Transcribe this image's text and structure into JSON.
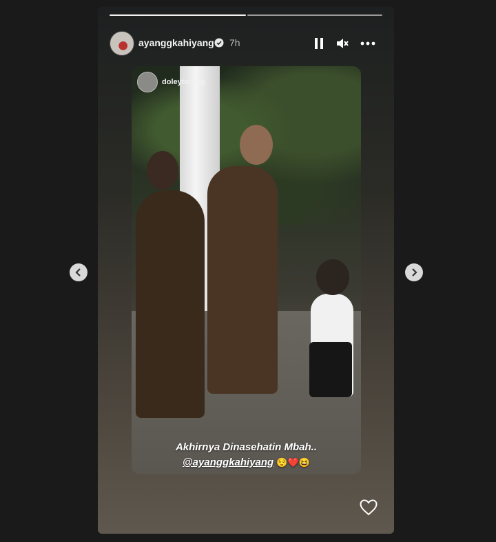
{
  "story": {
    "username": "ayanggkahiyang",
    "timestamp": "7h",
    "progress": [
      1.0,
      0.15
    ]
  },
  "header_controls": {
    "pause_icon": "pause-icon",
    "mute_icon": "speaker-muted-icon",
    "more_icon": "more-horizontal-icon"
  },
  "post": {
    "credit_username": "doleytobing",
    "caption_line1": "Akhirnya Dinasehatin Mbah..",
    "caption_mention": "@ayanggkahiyang",
    "caption_emojis": "😌❤️😆"
  },
  "colors": {
    "background": "#1a1a1a",
    "progress_active": "#f2f2f2",
    "verified_badge": "#ffffff"
  }
}
